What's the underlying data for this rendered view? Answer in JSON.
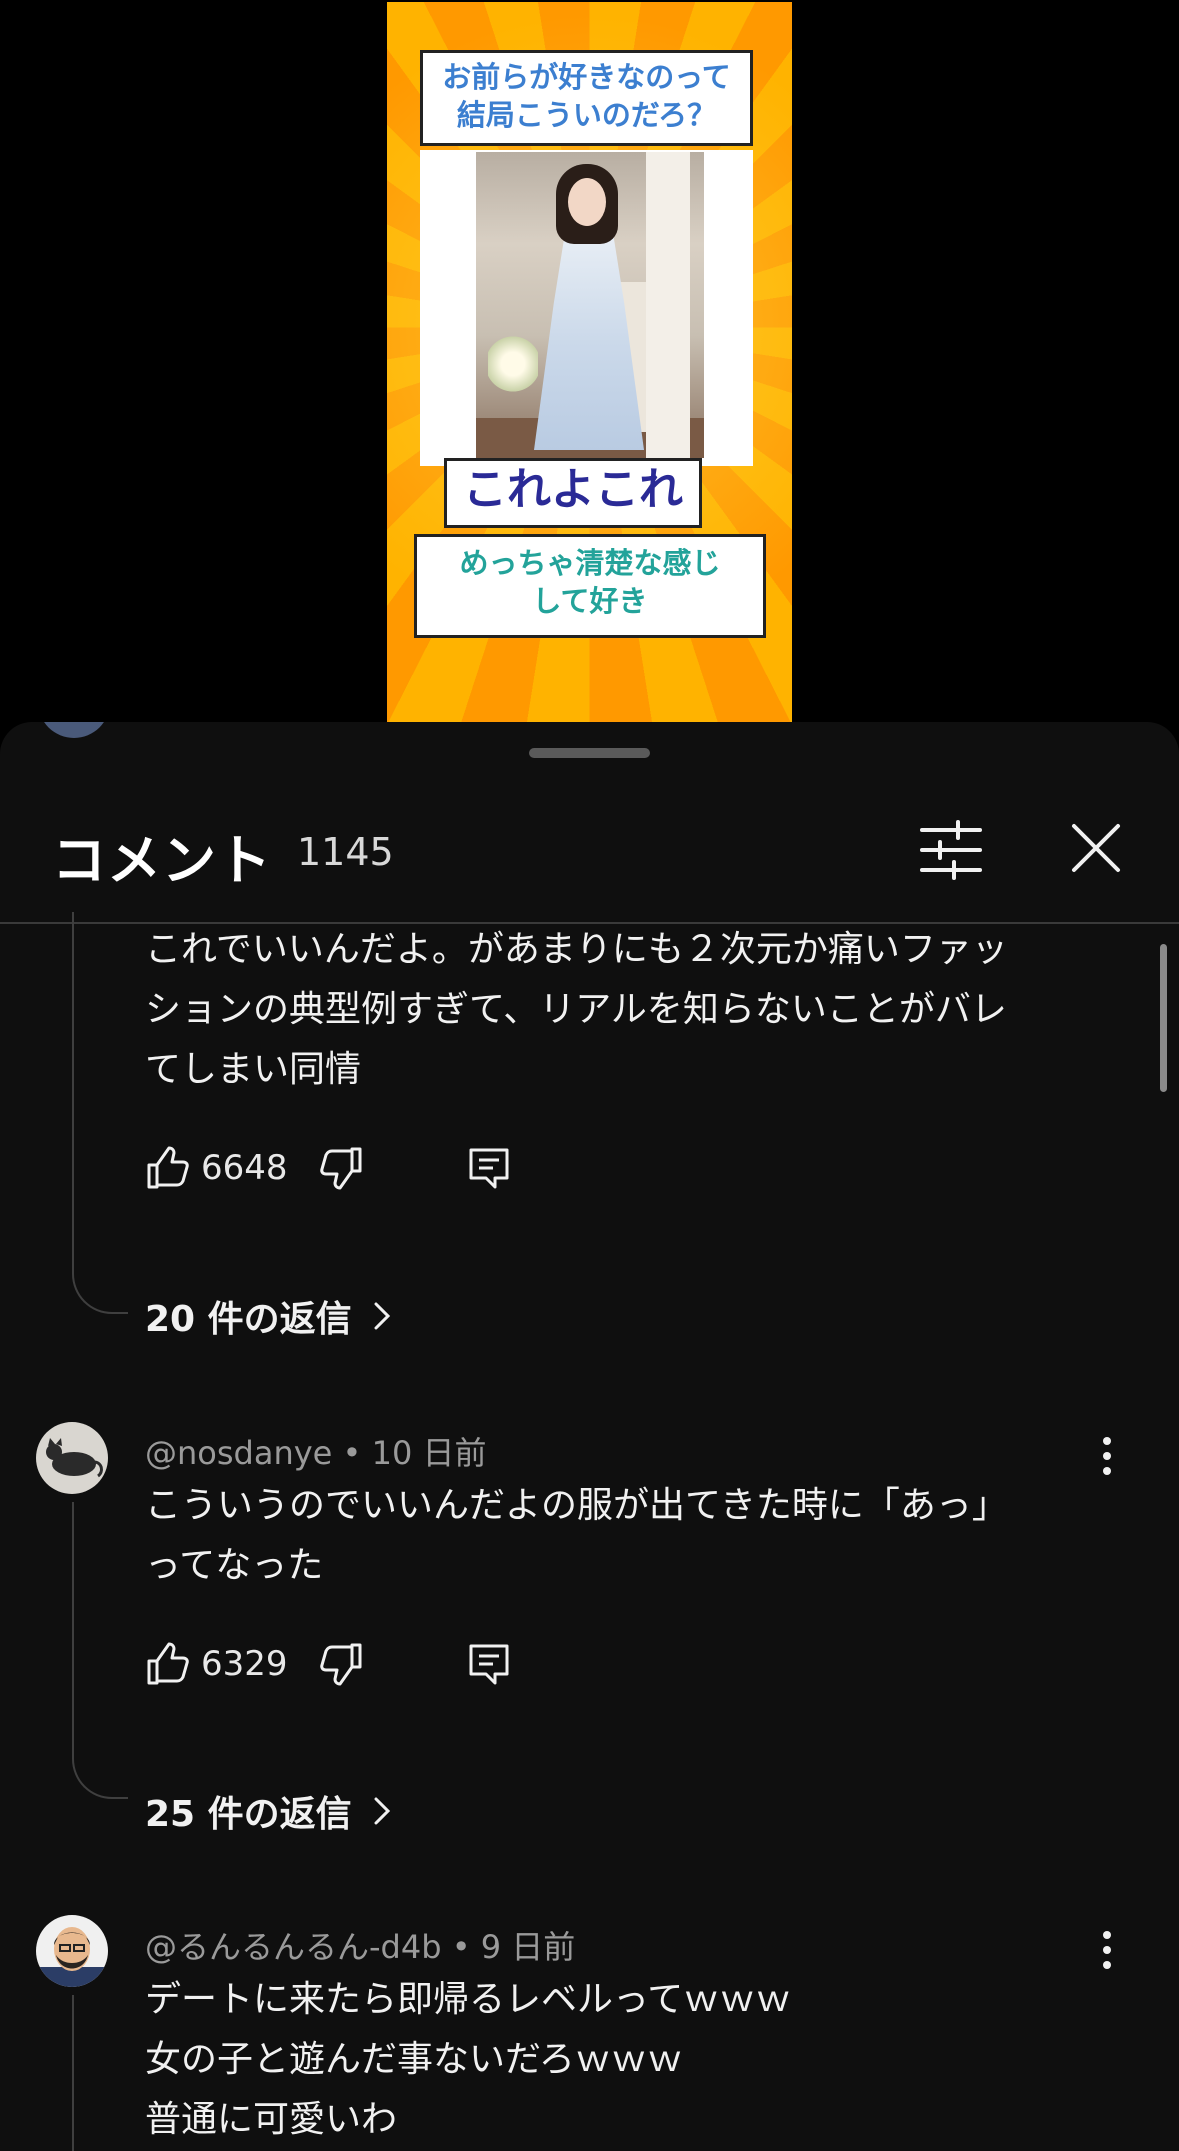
{
  "video": {
    "caption_top_line1": "お前らが好きなのって",
    "caption_top_line2": "結局こういのだろ？",
    "caption_mid": "これよこれ",
    "caption_bottom_line1": "めっちゃ清楚な感じ",
    "caption_bottom_line2": "して好き"
  },
  "panel": {
    "title": "コメント",
    "count": "1145",
    "filter_icon": "sliders-icon",
    "close_icon": "close-icon"
  },
  "comments": [
    {
      "author": "",
      "time": "",
      "lines": [
        "これでいいんだよ。があまりにも２次元か痛いファッ",
        "ションの典型例すぎて、リアルを知らないことがバレ",
        "てしまい同情"
      ],
      "likes": "6648",
      "replies": "20 件の返信"
    },
    {
      "author": "@nosdanye",
      "time": "10 日前",
      "lines": [
        "こういうのでいいんだよの服が出てきた時に「あっ」",
        "ってなった"
      ],
      "likes": "6329",
      "replies": "25 件の返信"
    },
    {
      "author": "@るんるんるん-d4b",
      "time": "9 日前",
      "lines": [
        "デートに来たら即帰るレベルってｗｗｗ",
        "女の子と遊んだ事ないだろｗｗｗ",
        "普通に可愛いわ"
      ],
      "likes": "",
      "replies": ""
    }
  ],
  "meta_separator": " • "
}
